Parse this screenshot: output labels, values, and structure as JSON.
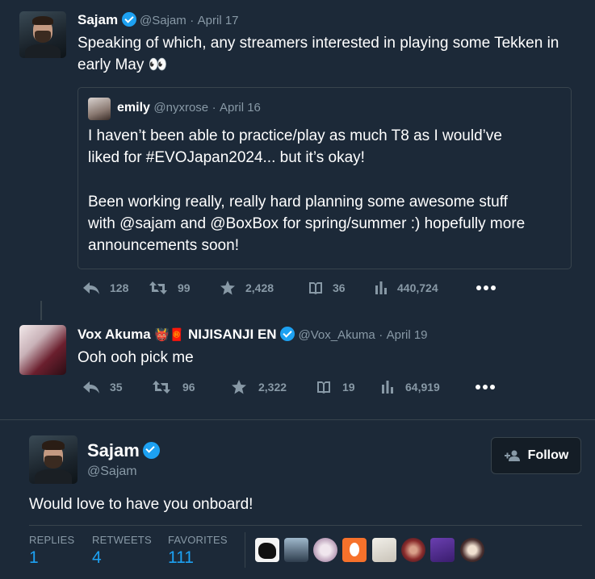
{
  "tweet1": {
    "name": "Sajam",
    "handle": "@Sajam",
    "sep": "·",
    "date": "April 17",
    "text_line1": "Speaking of which, any streamers interested in playing some Tekken in",
    "text_line2": "early May 👀",
    "quote": {
      "name": "emily",
      "handle": "@nyxrose",
      "sep": "·",
      "date": "April 16",
      "line1": "I haven’t been able to practice/play as much T8 as I would’ve",
      "line2": "liked for #EVOJapan2024... but it’s okay!",
      "line3": "Been working really, really hard planning some awesome stuff",
      "line4": "with @sajam and @BoxBox  for spring/summer :) hopefully more",
      "line5": "announcements soon!"
    },
    "actions": {
      "replies": "128",
      "retweets": "99",
      "likes": "2,428",
      "bookmarks": "36",
      "views": "440,724"
    }
  },
  "tweet2": {
    "name": "Vox Akuma",
    "emoji": "👹🧧",
    "affiliation": "NIJISANJI EN",
    "handle": "@Vox_Akuma",
    "sep": "·",
    "date": "April 19",
    "text": "Ooh ooh pick me",
    "actions": {
      "replies": "35",
      "retweets": "96",
      "likes": "2,322",
      "bookmarks": "19",
      "views": "64,919"
    }
  },
  "main": {
    "name": "Sajam",
    "handle": "@Sajam",
    "follow_label": "Follow",
    "text": "Would love to have you onboard!",
    "stats": {
      "replies_label": "REPLIES",
      "replies": "1",
      "retweets_label": "RETWEETS",
      "retweets": "4",
      "favorites_label": "FAVORITES",
      "favorites": "111"
    }
  },
  "colors": {
    "background": "#1c2938",
    "accent": "#1da1f2",
    "muted": "#8899a6",
    "border": "#38444d"
  },
  "icons": [
    "reply-icon",
    "retweet-icon",
    "star-icon",
    "bookmark-icon",
    "views-icon",
    "more-icon",
    "verified-icon",
    "add-user-icon"
  ]
}
